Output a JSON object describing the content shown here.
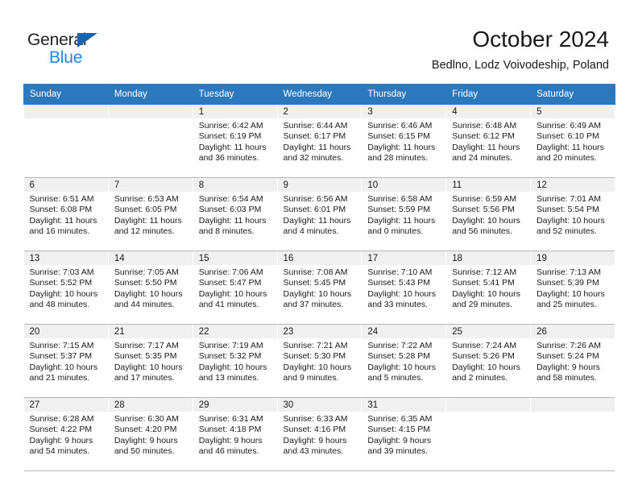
{
  "brand": {
    "word_one": "General",
    "word_two": "Blue",
    "triangle_icon": "triangle-icon",
    "primary_color": "#1464af",
    "secondary_color": "#1e87e5"
  },
  "header": {
    "title": "October 2024",
    "location": "Bedlno, Lodz Voivodeship, Poland"
  },
  "calendar": {
    "header_bg": "#2c78bd",
    "header_text_color": "#ffffff",
    "weekdays": [
      "Sunday",
      "Monday",
      "Tuesday",
      "Wednesday",
      "Thursday",
      "Friday",
      "Saturday"
    ],
    "labels": {
      "sunrise": "Sunrise:",
      "sunset": "Sunset:",
      "daylight": "Daylight:"
    },
    "weeks": [
      [
        {
          "day": ""
        },
        {
          "day": ""
        },
        {
          "day": "1",
          "sunrise": "Sunrise: 6:42 AM",
          "sunset": "Sunset: 6:19 PM",
          "daylight_line1": "Daylight: 11 hours",
          "daylight_line2": "and 36 minutes."
        },
        {
          "day": "2",
          "sunrise": "Sunrise: 6:44 AM",
          "sunset": "Sunset: 6:17 PM",
          "daylight_line1": "Daylight: 11 hours",
          "daylight_line2": "and 32 minutes."
        },
        {
          "day": "3",
          "sunrise": "Sunrise: 6:46 AM",
          "sunset": "Sunset: 6:15 PM",
          "daylight_line1": "Daylight: 11 hours",
          "daylight_line2": "and 28 minutes."
        },
        {
          "day": "4",
          "sunrise": "Sunrise: 6:48 AM",
          "sunset": "Sunset: 6:12 PM",
          "daylight_line1": "Daylight: 11 hours",
          "daylight_line2": "and 24 minutes."
        },
        {
          "day": "5",
          "sunrise": "Sunrise: 6:49 AM",
          "sunset": "Sunset: 6:10 PM",
          "daylight_line1": "Daylight: 11 hours",
          "daylight_line2": "and 20 minutes."
        }
      ],
      [
        {
          "day": "6",
          "sunrise": "Sunrise: 6:51 AM",
          "sunset": "Sunset: 6:08 PM",
          "daylight_line1": "Daylight: 11 hours",
          "daylight_line2": "and 16 minutes."
        },
        {
          "day": "7",
          "sunrise": "Sunrise: 6:53 AM",
          "sunset": "Sunset: 6:05 PM",
          "daylight_line1": "Daylight: 11 hours",
          "daylight_line2": "and 12 minutes."
        },
        {
          "day": "8",
          "sunrise": "Sunrise: 6:54 AM",
          "sunset": "Sunset: 6:03 PM",
          "daylight_line1": "Daylight: 11 hours",
          "daylight_line2": "and 8 minutes."
        },
        {
          "day": "9",
          "sunrise": "Sunrise: 6:56 AM",
          "sunset": "Sunset: 6:01 PM",
          "daylight_line1": "Daylight: 11 hours",
          "daylight_line2": "and 4 minutes."
        },
        {
          "day": "10",
          "sunrise": "Sunrise: 6:58 AM",
          "sunset": "Sunset: 5:59 PM",
          "daylight_line1": "Daylight: 11 hours",
          "daylight_line2": "and 0 minutes."
        },
        {
          "day": "11",
          "sunrise": "Sunrise: 6:59 AM",
          "sunset": "Sunset: 5:56 PM",
          "daylight_line1": "Daylight: 10 hours",
          "daylight_line2": "and 56 minutes."
        },
        {
          "day": "12",
          "sunrise": "Sunrise: 7:01 AM",
          "sunset": "Sunset: 5:54 PM",
          "daylight_line1": "Daylight: 10 hours",
          "daylight_line2": "and 52 minutes."
        }
      ],
      [
        {
          "day": "13",
          "sunrise": "Sunrise: 7:03 AM",
          "sunset": "Sunset: 5:52 PM",
          "daylight_line1": "Daylight: 10 hours",
          "daylight_line2": "and 48 minutes."
        },
        {
          "day": "14",
          "sunrise": "Sunrise: 7:05 AM",
          "sunset": "Sunset: 5:50 PM",
          "daylight_line1": "Daylight: 10 hours",
          "daylight_line2": "and 44 minutes."
        },
        {
          "day": "15",
          "sunrise": "Sunrise: 7:06 AM",
          "sunset": "Sunset: 5:47 PM",
          "daylight_line1": "Daylight: 10 hours",
          "daylight_line2": "and 41 minutes."
        },
        {
          "day": "16",
          "sunrise": "Sunrise: 7:08 AM",
          "sunset": "Sunset: 5:45 PM",
          "daylight_line1": "Daylight: 10 hours",
          "daylight_line2": "and 37 minutes."
        },
        {
          "day": "17",
          "sunrise": "Sunrise: 7:10 AM",
          "sunset": "Sunset: 5:43 PM",
          "daylight_line1": "Daylight: 10 hours",
          "daylight_line2": "and 33 minutes."
        },
        {
          "day": "18",
          "sunrise": "Sunrise: 7:12 AM",
          "sunset": "Sunset: 5:41 PM",
          "daylight_line1": "Daylight: 10 hours",
          "daylight_line2": "and 29 minutes."
        },
        {
          "day": "19",
          "sunrise": "Sunrise: 7:13 AM",
          "sunset": "Sunset: 5:39 PM",
          "daylight_line1": "Daylight: 10 hours",
          "daylight_line2": "and 25 minutes."
        }
      ],
      [
        {
          "day": "20",
          "sunrise": "Sunrise: 7:15 AM",
          "sunset": "Sunset: 5:37 PM",
          "daylight_line1": "Daylight: 10 hours",
          "daylight_line2": "and 21 minutes."
        },
        {
          "day": "21",
          "sunrise": "Sunrise: 7:17 AM",
          "sunset": "Sunset: 5:35 PM",
          "daylight_line1": "Daylight: 10 hours",
          "daylight_line2": "and 17 minutes."
        },
        {
          "day": "22",
          "sunrise": "Sunrise: 7:19 AM",
          "sunset": "Sunset: 5:32 PM",
          "daylight_line1": "Daylight: 10 hours",
          "daylight_line2": "and 13 minutes."
        },
        {
          "day": "23",
          "sunrise": "Sunrise: 7:21 AM",
          "sunset": "Sunset: 5:30 PM",
          "daylight_line1": "Daylight: 10 hours",
          "daylight_line2": "and 9 minutes."
        },
        {
          "day": "24",
          "sunrise": "Sunrise: 7:22 AM",
          "sunset": "Sunset: 5:28 PM",
          "daylight_line1": "Daylight: 10 hours",
          "daylight_line2": "and 5 minutes."
        },
        {
          "day": "25",
          "sunrise": "Sunrise: 7:24 AM",
          "sunset": "Sunset: 5:26 PM",
          "daylight_line1": "Daylight: 10 hours",
          "daylight_line2": "and 2 minutes."
        },
        {
          "day": "26",
          "sunrise": "Sunrise: 7:26 AM",
          "sunset": "Sunset: 5:24 PM",
          "daylight_line1": "Daylight: 9 hours",
          "daylight_line2": "and 58 minutes."
        }
      ],
      [
        {
          "day": "27",
          "sunrise": "Sunrise: 6:28 AM",
          "sunset": "Sunset: 4:22 PM",
          "daylight_line1": "Daylight: 9 hours",
          "daylight_line2": "and 54 minutes."
        },
        {
          "day": "28",
          "sunrise": "Sunrise: 6:30 AM",
          "sunset": "Sunset: 4:20 PM",
          "daylight_line1": "Daylight: 9 hours",
          "daylight_line2": "and 50 minutes."
        },
        {
          "day": "29",
          "sunrise": "Sunrise: 6:31 AM",
          "sunset": "Sunset: 4:18 PM",
          "daylight_line1": "Daylight: 9 hours",
          "daylight_line2": "and 46 minutes."
        },
        {
          "day": "30",
          "sunrise": "Sunrise: 6:33 AM",
          "sunset": "Sunset: 4:16 PM",
          "daylight_line1": "Daylight: 9 hours",
          "daylight_line2": "and 43 minutes."
        },
        {
          "day": "31",
          "sunrise": "Sunrise: 6:35 AM",
          "sunset": "Sunset: 4:15 PM",
          "daylight_line1": "Daylight: 9 hours",
          "daylight_line2": "and 39 minutes."
        },
        {
          "day": ""
        },
        {
          "day": ""
        }
      ]
    ]
  }
}
